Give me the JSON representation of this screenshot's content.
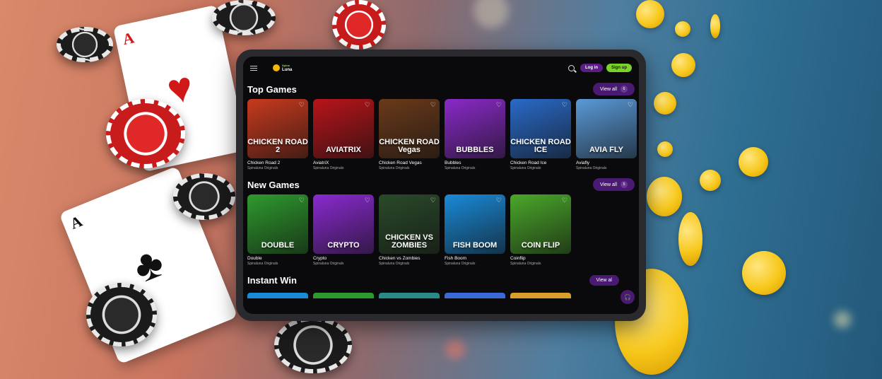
{
  "app": {
    "logo_small": "Spina",
    "logo_main": "Luna",
    "login_label": "Log in",
    "signup_label": "Sign up"
  },
  "sections": [
    {
      "title": "Top Games",
      "view_all": "View all",
      "count": "6",
      "games": [
        {
          "art": "CHICKEN ROAD 2",
          "name": "Chicken Road 2",
          "provider": "Spinaluna Originals",
          "color": "#c83a1e"
        },
        {
          "art": "AVIATRIX",
          "name": "AviatriX",
          "provider": "Spinaluna Originals",
          "color": "#b8141a"
        },
        {
          "art": "CHICKEN ROAD Vegas",
          "name": "Chicken Road Vegas",
          "provider": "Spinaluna Originals",
          "color": "#6a3a1a"
        },
        {
          "art": "BUBBLES",
          "name": "Bubbles",
          "provider": "Spinaluna Originals",
          "color": "#8a2ac8"
        },
        {
          "art": "CHICKEN ROAD ICE",
          "name": "Chicken Road Ice",
          "provider": "Spinaluna Originals",
          "color": "#2a6ac8"
        },
        {
          "art": "AVIA FLY",
          "name": "Aviafly",
          "provider": "Spinaluna Originals",
          "color": "#5a9ad8"
        }
      ]
    },
    {
      "title": "New Games",
      "view_all": "View all",
      "count": "5",
      "games": [
        {
          "art": "DOUBLE",
          "name": "Double",
          "provider": "Spinaluna Originals",
          "color": "#2e9a2e"
        },
        {
          "art": "CRYPTO",
          "name": "Crypto",
          "provider": "Spinaluna Originals",
          "color": "#8a2ad0"
        },
        {
          "art": "CHICKEN VS ZOMBIES",
          "name": "Chicken vs Zombies",
          "provider": "Spinaluna Originals",
          "color": "#2a4a2a"
        },
        {
          "art": "FISH BOOM",
          "name": "Fish Boom",
          "provider": "Spinaluna Originals",
          "color": "#1a8ad8"
        },
        {
          "art": "COIN FLIP",
          "name": "Coinflip",
          "provider": "Spinaluna Originals",
          "color": "#4aa82a"
        }
      ]
    },
    {
      "title": "Instant Win",
      "view_all": "View al"
    }
  ],
  "colors": {
    "accent_purple": "#4a1a72",
    "accent_green": "#7bd32a"
  }
}
